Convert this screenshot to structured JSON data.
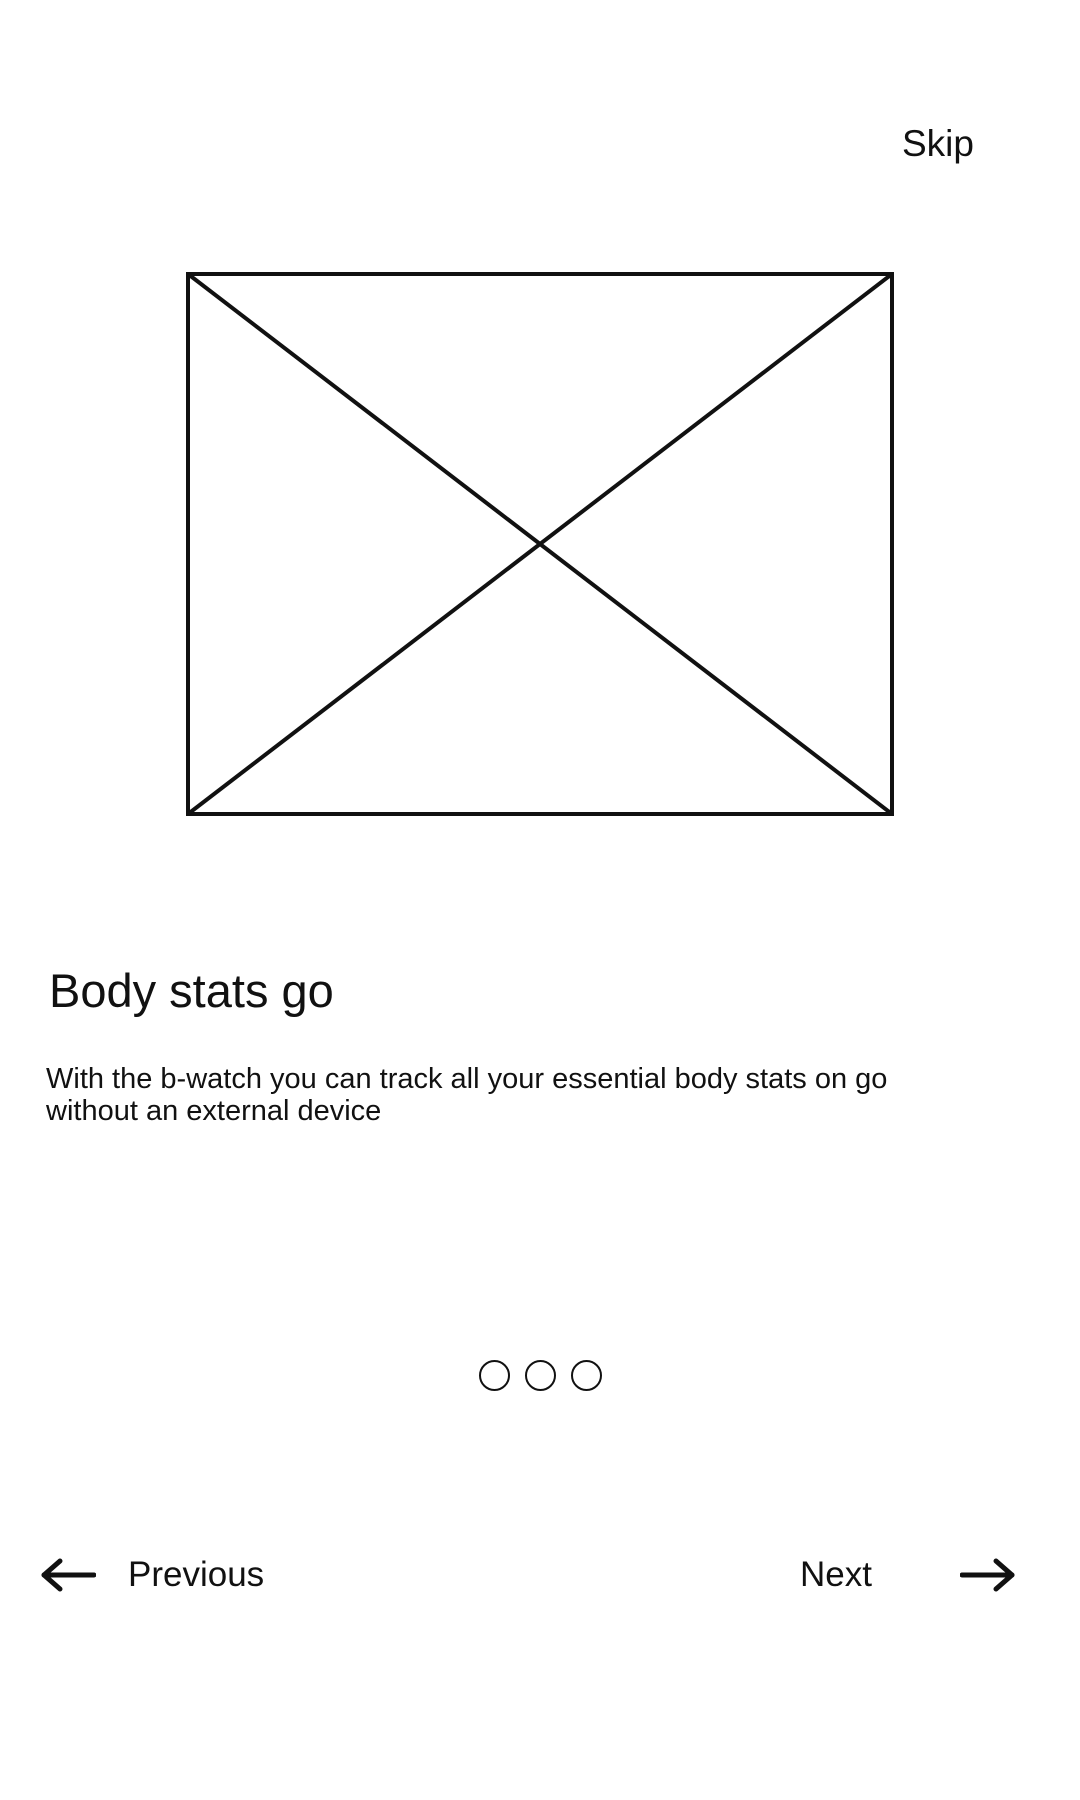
{
  "header": {
    "skip_label": "Skip"
  },
  "hero": {
    "icon": "image-placeholder-icon"
  },
  "content": {
    "title": "Body stats go",
    "description": "With the b-watch you can track all your essential body stats on go without an external device"
  },
  "pagination": {
    "total": 3,
    "dots": [
      "page-1",
      "page-2",
      "page-3"
    ]
  },
  "navigation": {
    "previous_label": "Previous",
    "next_label": "Next",
    "previous_icon": "arrow-left-icon",
    "next_icon": "arrow-right-icon"
  },
  "colors": {
    "stroke": "#111111",
    "background": "#ffffff"
  }
}
